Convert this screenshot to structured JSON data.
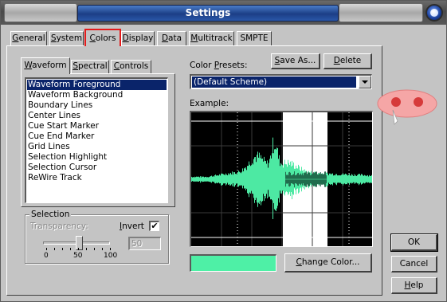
{
  "window": {
    "title": "Settings"
  },
  "tabs": [
    "General",
    "System",
    "Colors",
    "Display",
    "Data",
    "Multitrack",
    "SMPTE"
  ],
  "active_tab": "Colors",
  "subtabs": [
    "Waveform",
    "Spectral",
    "Controls"
  ],
  "active_subtab": "Waveform",
  "element_list": {
    "items": [
      "Waveform Foreground",
      "Waveform Background",
      "Boundary Lines",
      "Center Lines",
      "Cue Start Marker",
      "Cue End Marker",
      "Grid Lines",
      "Selection Highlight",
      "Selection Cursor",
      "ReWire Track"
    ],
    "selected": "Waveform Foreground"
  },
  "selection": {
    "legend": "Selection",
    "transparency_label": "Transparency:",
    "invert_label": "Invert",
    "invert_checked": true,
    "transparency_value": "50",
    "slider_value": 50,
    "slider_ticks": [
      "0",
      "50",
      "100"
    ]
  },
  "presets": {
    "label": "Color Presets:",
    "selected": "(Default Scheme)",
    "save_as_label": "Save As...",
    "delete_label": "Delete"
  },
  "example": {
    "label": "Example:",
    "colors": {
      "background": "#000000",
      "waveform": "#4de9a3",
      "waveform_dark": "#1c5e44",
      "selection_highlight": "#ffffff",
      "grid": "#3a3a3a"
    }
  },
  "swatch": {
    "color": "#4ef0a6"
  },
  "change_color_label": "Change Color...",
  "dialog_buttons": {
    "ok": "OK",
    "cancel": "Cancel",
    "help": "Help"
  },
  "colors": {
    "highlight_tab": "#e41b1b",
    "selection_blue": "#0a246a",
    "cursor_pink": "#f5a6a6",
    "cursor_red": "#d63a3a"
  }
}
